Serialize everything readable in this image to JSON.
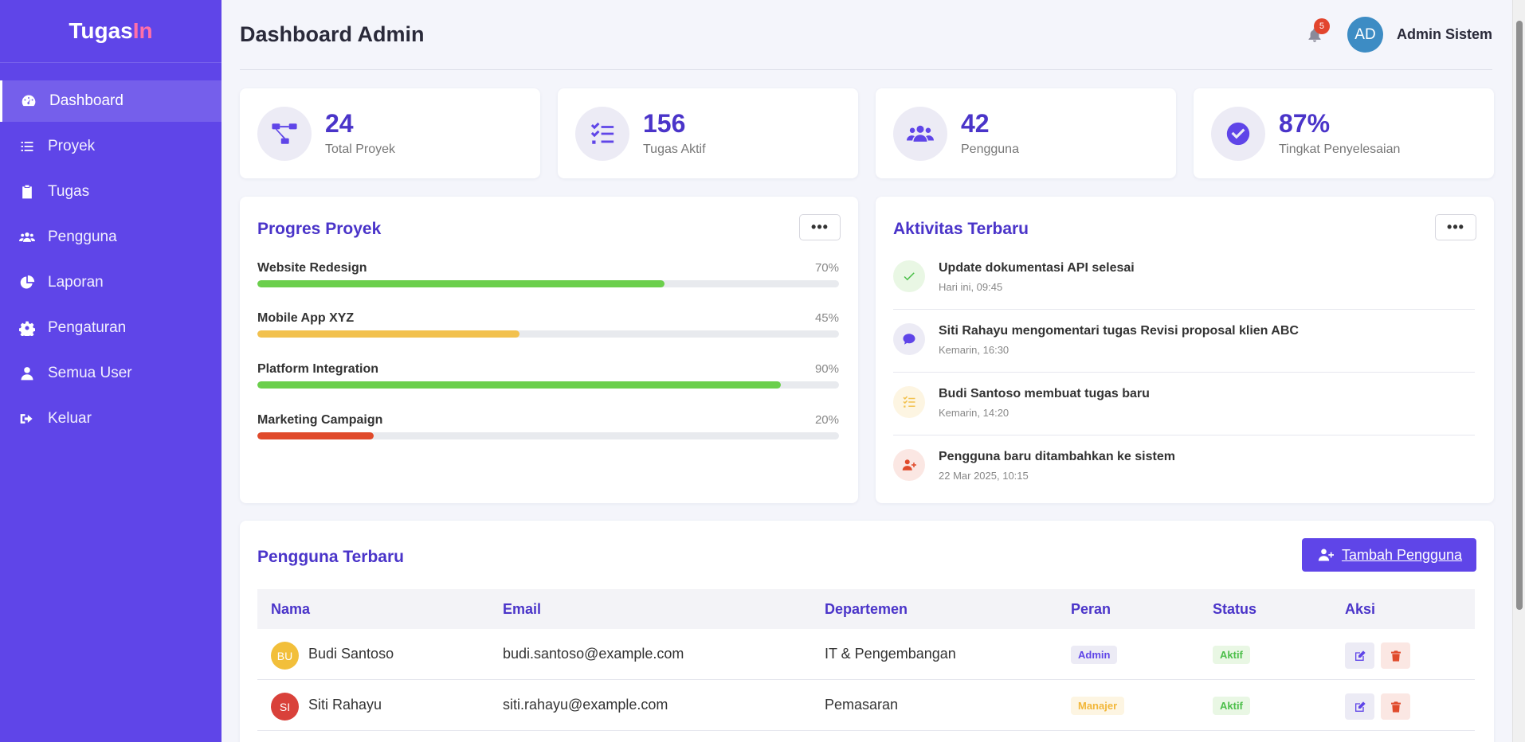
{
  "brand": {
    "part1": "Tugas",
    "part2": "In"
  },
  "sidebar": {
    "items": [
      {
        "label": "Dashboard",
        "icon": "gauge-icon",
        "active": true
      },
      {
        "label": "Proyek",
        "icon": "list-icon"
      },
      {
        "label": "Tugas",
        "icon": "clipboard-icon"
      },
      {
        "label": "Pengguna",
        "icon": "users-icon"
      },
      {
        "label": "Laporan",
        "icon": "pie-chart-icon"
      },
      {
        "label": "Pengaturan",
        "icon": "gear-icon"
      },
      {
        "label": "Semua User",
        "icon": "user-icon"
      },
      {
        "label": "Keluar",
        "icon": "sign-out-icon"
      }
    ]
  },
  "header": {
    "title": "Dashboard Admin",
    "notif_count": "5",
    "avatar_initials": "AD",
    "user_name": "Admin Sistem"
  },
  "stats": [
    {
      "value": "24",
      "label": "Total Proyek",
      "icon": "project-diagram-icon"
    },
    {
      "value": "156",
      "label": "Tugas Aktif",
      "icon": "tasks-icon"
    },
    {
      "value": "42",
      "label": "Pengguna",
      "icon": "users-icon"
    },
    {
      "value": "87%",
      "label": "Tingkat Penyelesaian",
      "icon": "check-circle-icon"
    }
  ],
  "progress": {
    "title": "Progres Proyek",
    "more": "•••",
    "items": [
      {
        "name": "Website Redesign",
        "pct": "70%",
        "value": 70,
        "color": "#6bcf4c"
      },
      {
        "name": "Mobile App XYZ",
        "pct": "45%",
        "value": 45,
        "color": "#f2c14e"
      },
      {
        "name": "Platform Integration",
        "pct": "90%",
        "value": 90,
        "color": "#6bcf4c"
      },
      {
        "name": "Marketing Campaign",
        "pct": "20%",
        "value": 20,
        "color": "#e04a2b"
      }
    ]
  },
  "activity": {
    "title": "Aktivitas Terbaru",
    "more": "•••",
    "items": [
      {
        "title": "Update dokumentasi API selesai",
        "time": "Hari ini, 09:45",
        "icon": "check-icon"
      },
      {
        "title": "Siti Rahayu mengomentari tugas Revisi proposal klien ABC",
        "time": "Kemarin, 16:30",
        "icon": "comment-icon"
      },
      {
        "title": "Budi Santoso membuat tugas baru",
        "time": "Kemarin, 14:20",
        "icon": "tasks-icon"
      },
      {
        "title": "Pengguna baru ditambahkan ke sistem",
        "time": "22 Mar 2025, 10:15",
        "icon": "user-plus-icon"
      }
    ]
  },
  "users": {
    "title": "Pengguna Terbaru",
    "add_label": "Tambah Pengguna",
    "columns": [
      "Nama",
      "Email",
      "Departemen",
      "Peran",
      "Status",
      "Aksi"
    ],
    "rows": [
      {
        "initials": "BU",
        "avatar_color": "#f2bf3a",
        "name": "Budi Santoso",
        "email": "budi.santoso@example.com",
        "dept": "IT & Pengembangan",
        "role": "Admin",
        "status": "Aktif"
      },
      {
        "initials": "SI",
        "avatar_color": "#d9413a",
        "name": "Siti Rahayu",
        "email": "siti.rahayu@example.com",
        "dept": "Pemasaran",
        "role": "Manajer",
        "status": "Aktif"
      }
    ]
  }
}
